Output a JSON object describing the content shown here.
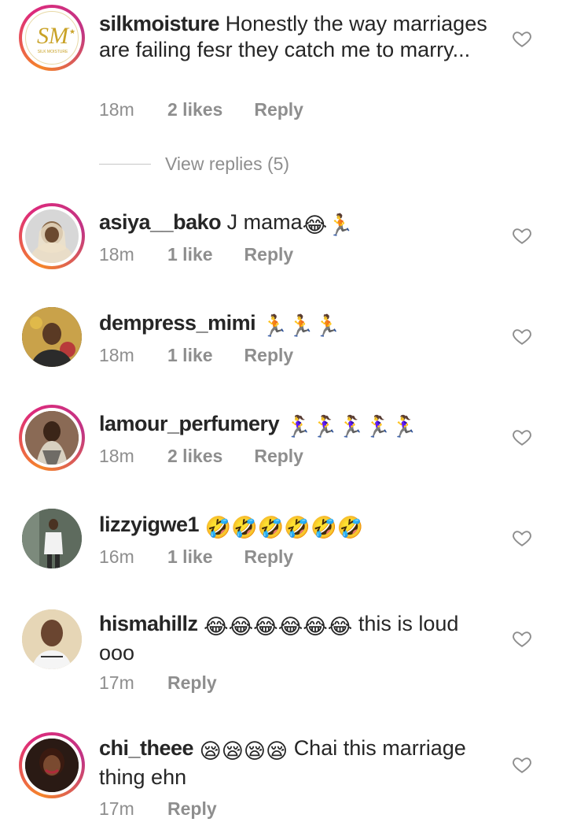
{
  "comments": [
    {
      "username": "silkmoisture",
      "text": "Honestly the way marriages are failing fesr they catch me to marry...",
      "time": "18m",
      "likes": "2 likes",
      "reply": "Reply",
      "avatar_logo": "SM",
      "avatar_logo_sub": "SILK MOISTURE",
      "view_replies": "View replies (5)"
    },
    {
      "username": "asiya__bako",
      "text": "J mama",
      "emojis": "😂🏃",
      "time": "18m",
      "likes": "1 like",
      "reply": "Reply"
    },
    {
      "username": "dempress_mimi",
      "text": "",
      "emojis": "🏃🏃🏃",
      "time": "18m",
      "likes": "1 like",
      "reply": "Reply"
    },
    {
      "username": "lamour_perfumery",
      "text": "",
      "emojis": "🏃‍♀️🏃‍♀️🏃‍♀️🏃‍♀️🏃‍♀️",
      "time": "18m",
      "likes": "2 likes",
      "reply": "Reply"
    },
    {
      "username": "lizzyigwe1",
      "text": "",
      "emojis": "🤣🤣🤣🤣🤣🤣",
      "time": "16m",
      "likes": "1 like",
      "reply": "Reply"
    },
    {
      "username": "hismahillz",
      "text": "this is loud ooo",
      "emojis": "😂😂😂😂😂😂",
      "time": "17m",
      "likes": "",
      "reply": "Reply"
    },
    {
      "username": "chi_theee",
      "text": "Chai this marriage thing ehn",
      "emojis": "😪😪😪😪",
      "time": "17m",
      "likes": "",
      "reply": "Reply"
    }
  ],
  "icons": {
    "like": "heart-outline-icon"
  },
  "colors": {
    "meta_text": "#8e8e8e",
    "username": "#262626",
    "story_ring": "#dd2a7b",
    "logo_gold": "#c9a227"
  }
}
